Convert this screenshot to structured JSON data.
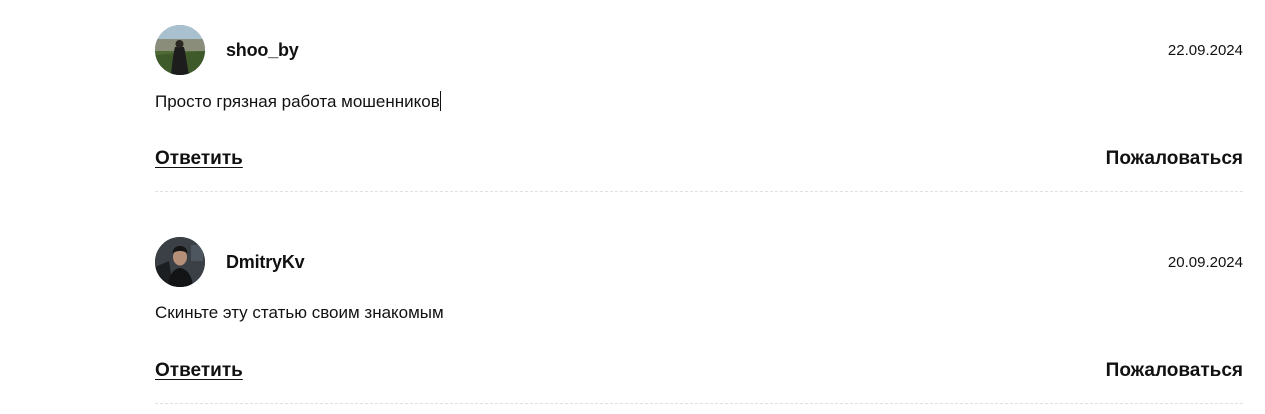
{
  "comments": [
    {
      "username": "shoo_by",
      "date": "22.09.2024",
      "text": "Просто грязная работа мошенников",
      "reply_label": "Ответить",
      "report_label": "Пожаловаться",
      "avatar": "user-photo-avatar"
    },
    {
      "username": "DmitryKv",
      "date": "20.09.2024",
      "text": "Скиньте эту статью своим знакомым",
      "reply_label": "Ответить",
      "report_label": "Пожаловаться",
      "avatar": "user-photo-avatar"
    }
  ]
}
